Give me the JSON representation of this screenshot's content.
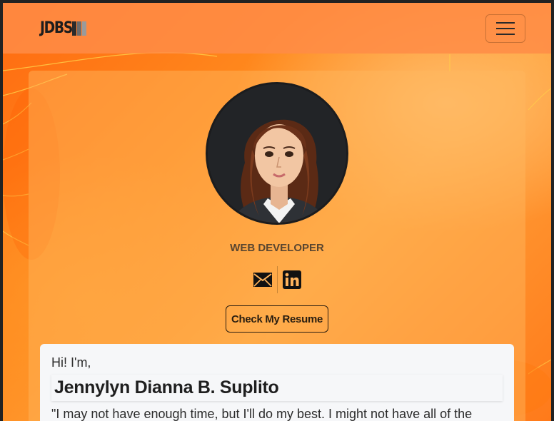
{
  "navbar": {
    "brand": "JDBS",
    "brand_bar_colors": [
      "#2b2b2b",
      "#6b6b6b",
      "#9a9a9a"
    ],
    "toggle_icon": "hamburger-menu-icon"
  },
  "profile": {
    "avatar_icon": "profile-portrait",
    "role": "WEB DEVELOPER",
    "socials": [
      {
        "icon": "envelope-icon"
      },
      {
        "icon": "linkedin-icon"
      }
    ],
    "resume_button": "Check My Resume"
  },
  "intro": {
    "greeting": "Hi! I'm,",
    "name": "Jennylyn Dianna B. Suplito",
    "quote": "\"I may not have enough time, but I'll do my best. I might not have all of the"
  },
  "colors": {
    "accent": "#ff8a1e",
    "card_text": "#2a1e10"
  }
}
